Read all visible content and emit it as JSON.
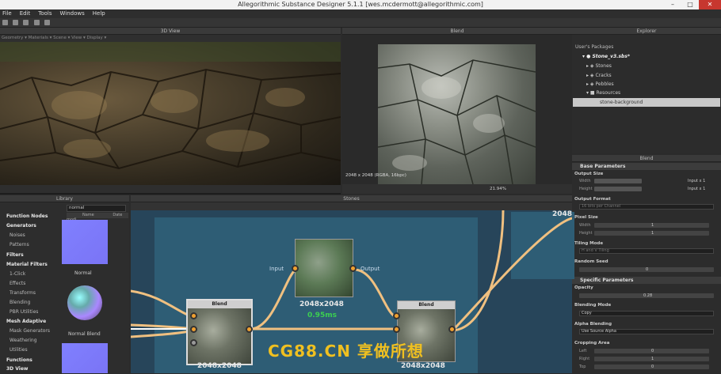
{
  "window": {
    "title": "Allegorithmic Substance Designer 5.1.1 [wes.mcdermott@allegorithmic.com]"
  },
  "menu": [
    "File",
    "Edit",
    "Tools",
    "Windows",
    "Help"
  ],
  "view3d": {
    "title": "3D View",
    "subbar": "Geometry ▾  Materials ▾  Scene ▾  View ▾  Display ▾"
  },
  "view2d": {
    "title": "Blend",
    "size_text": "2048 x 2048 (RGBA, 16bpc)",
    "zoom": "21.94%"
  },
  "explorer": {
    "title": "Explorer",
    "header": "User's Packages",
    "package": "Stone_v3.sbs*",
    "items": [
      "Stones",
      "Cracks",
      "Pebbles",
      "Resources"
    ],
    "resource": "stone-background"
  },
  "params": {
    "panel_title": "Blend",
    "base_title": "Base Parameters",
    "output_size": "Output Size",
    "width": "Width",
    "height": "Height",
    "width_mode": "Input x 1",
    "height_mode": "Input x 1",
    "output_format": "Output Format",
    "format_value": "16 bits per Channel",
    "pixel_size": "Pixel Size",
    "px_width": "Width",
    "px_height": "Height",
    "px_width_val": "1",
    "px_height_val": "1",
    "tiling_mode": "Tiling Mode",
    "tiling_value": "H and V Tiling",
    "random_seed": "Random Seed",
    "seed_val": "0",
    "specific_title": "Specific Parameters",
    "opacity": "Opacity",
    "opacity_val": "0.28",
    "blending_mode": "Blending Mode",
    "blending_value": "Copy",
    "alpha_blending": "Alpha Blending",
    "alpha_value": "Use Source Alpha",
    "cropping_area": "Cropping Area",
    "left": "Left",
    "right": "Right",
    "top": "Top",
    "left_val": "0",
    "right_val": "1",
    "top_val": "0"
  },
  "library": {
    "title": "Library",
    "search": "normal",
    "col_name": "Name",
    "col_date": "Date modi",
    "categories": [
      {
        "label": "Function Nodes",
        "bold": true
      },
      {
        "label": "Generators",
        "bold": true
      },
      {
        "label": "Noises",
        "bold": false
      },
      {
        "label": "Patterns",
        "bold": false
      },
      {
        "label": "Filters",
        "bold": true
      },
      {
        "label": "Material Filters",
        "bold": true
      },
      {
        "label": "1-Click",
        "bold": false
      },
      {
        "label": "Effects",
        "bold": false
      },
      {
        "label": "Transforms",
        "bold": false
      },
      {
        "label": "Blending",
        "bold": false
      },
      {
        "label": "PBR Utilities",
        "bold": false
      },
      {
        "label": "Mesh Adaptive",
        "bold": true
      },
      {
        "label": "Mask Generators",
        "bold": false
      },
      {
        "label": "Weathering",
        "bold": false
      },
      {
        "label": "Utilities",
        "bold": false
      },
      {
        "label": "Functions",
        "bold": true
      },
      {
        "label": "3D View",
        "bold": true
      }
    ],
    "thumb1": "Normal",
    "thumb2": "Normal Blend"
  },
  "graph": {
    "title": "Stones",
    "node_blend1": "Blend",
    "node_blend2": "Blend",
    "size1": "2048x2048",
    "size2": "2048x2048",
    "size3": "2048x2048",
    "size4": "2048",
    "time": "0.95ms",
    "input_label": "Input",
    "output_label": "Output"
  },
  "watermark": "CG88.CN 享做所想",
  "colors": {
    "accent": "#f0a030",
    "time": "#3cd050",
    "graph_bg": "#27455a"
  }
}
